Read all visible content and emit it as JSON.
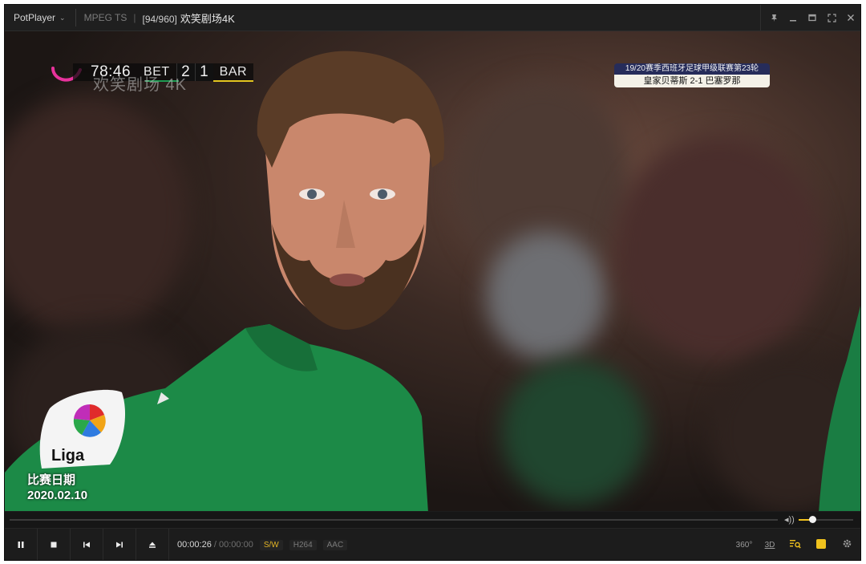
{
  "titlebar": {
    "app_name": "PotPlayer",
    "format": "MPEG TS",
    "playlist_position": "[94/960]",
    "channel_title": "欢笑剧场4K",
    "icons": [
      "pin-icon",
      "minimize-icon",
      "maximize-icon",
      "fullscreen-icon",
      "close-icon"
    ]
  },
  "overlay": {
    "clock": "78:46",
    "home_team": "BET",
    "home_score": "2",
    "away_score": "1",
    "away_team": "BAR",
    "watermark": "欢笑剧场 4K",
    "match_round": "19/20赛季西班牙足球甲级联赛第23轮",
    "match_result": "皇家贝蒂斯 2-1 巴塞罗那",
    "date_label": "比赛日期",
    "date_value": "2020.02.10",
    "colors": {
      "home_underline": "#1f9a52",
      "away_underline": "#e3c51f",
      "round_bg": "#262c5a"
    }
  },
  "seekbar": {
    "progress": 0,
    "volume_level": 0.25
  },
  "controls": {
    "buttons": [
      "pause-icon",
      "stop-icon",
      "previous-icon",
      "next-icon",
      "eject-icon"
    ],
    "current_time": "00:00:26",
    "separator": "/",
    "total_time": "00:00:00",
    "decoder": "S/W",
    "video_codec": "H264",
    "audio_codec": "AAC",
    "right": {
      "vr": "360°",
      "three_d": "3D"
    },
    "accent": "#f0c21d"
  }
}
